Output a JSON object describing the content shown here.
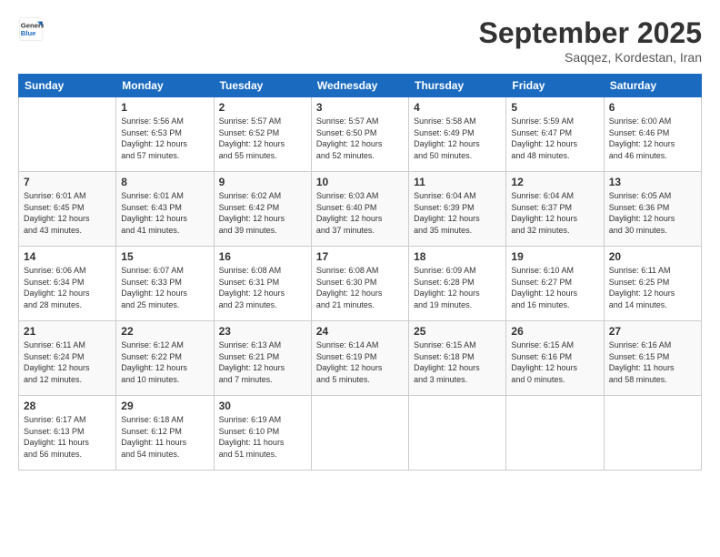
{
  "header": {
    "logo_line1": "General",
    "logo_line2": "Blue",
    "month_title": "September 2025",
    "location": "Saqqez, Kordestan, Iran"
  },
  "weekdays": [
    "Sunday",
    "Monday",
    "Tuesday",
    "Wednesday",
    "Thursday",
    "Friday",
    "Saturday"
  ],
  "weeks": [
    [
      {
        "day": "",
        "info": ""
      },
      {
        "day": "1",
        "info": "Sunrise: 5:56 AM\nSunset: 6:53 PM\nDaylight: 12 hours\nand 57 minutes."
      },
      {
        "day": "2",
        "info": "Sunrise: 5:57 AM\nSunset: 6:52 PM\nDaylight: 12 hours\nand 55 minutes."
      },
      {
        "day": "3",
        "info": "Sunrise: 5:57 AM\nSunset: 6:50 PM\nDaylight: 12 hours\nand 52 minutes."
      },
      {
        "day": "4",
        "info": "Sunrise: 5:58 AM\nSunset: 6:49 PM\nDaylight: 12 hours\nand 50 minutes."
      },
      {
        "day": "5",
        "info": "Sunrise: 5:59 AM\nSunset: 6:47 PM\nDaylight: 12 hours\nand 48 minutes."
      },
      {
        "day": "6",
        "info": "Sunrise: 6:00 AM\nSunset: 6:46 PM\nDaylight: 12 hours\nand 46 minutes."
      }
    ],
    [
      {
        "day": "7",
        "info": "Sunrise: 6:01 AM\nSunset: 6:45 PM\nDaylight: 12 hours\nand 43 minutes."
      },
      {
        "day": "8",
        "info": "Sunrise: 6:01 AM\nSunset: 6:43 PM\nDaylight: 12 hours\nand 41 minutes."
      },
      {
        "day": "9",
        "info": "Sunrise: 6:02 AM\nSunset: 6:42 PM\nDaylight: 12 hours\nand 39 minutes."
      },
      {
        "day": "10",
        "info": "Sunrise: 6:03 AM\nSunset: 6:40 PM\nDaylight: 12 hours\nand 37 minutes."
      },
      {
        "day": "11",
        "info": "Sunrise: 6:04 AM\nSunset: 6:39 PM\nDaylight: 12 hours\nand 35 minutes."
      },
      {
        "day": "12",
        "info": "Sunrise: 6:04 AM\nSunset: 6:37 PM\nDaylight: 12 hours\nand 32 minutes."
      },
      {
        "day": "13",
        "info": "Sunrise: 6:05 AM\nSunset: 6:36 PM\nDaylight: 12 hours\nand 30 minutes."
      }
    ],
    [
      {
        "day": "14",
        "info": "Sunrise: 6:06 AM\nSunset: 6:34 PM\nDaylight: 12 hours\nand 28 minutes."
      },
      {
        "day": "15",
        "info": "Sunrise: 6:07 AM\nSunset: 6:33 PM\nDaylight: 12 hours\nand 25 minutes."
      },
      {
        "day": "16",
        "info": "Sunrise: 6:08 AM\nSunset: 6:31 PM\nDaylight: 12 hours\nand 23 minutes."
      },
      {
        "day": "17",
        "info": "Sunrise: 6:08 AM\nSunset: 6:30 PM\nDaylight: 12 hours\nand 21 minutes."
      },
      {
        "day": "18",
        "info": "Sunrise: 6:09 AM\nSunset: 6:28 PM\nDaylight: 12 hours\nand 19 minutes."
      },
      {
        "day": "19",
        "info": "Sunrise: 6:10 AM\nSunset: 6:27 PM\nDaylight: 12 hours\nand 16 minutes."
      },
      {
        "day": "20",
        "info": "Sunrise: 6:11 AM\nSunset: 6:25 PM\nDaylight: 12 hours\nand 14 minutes."
      }
    ],
    [
      {
        "day": "21",
        "info": "Sunrise: 6:11 AM\nSunset: 6:24 PM\nDaylight: 12 hours\nand 12 minutes."
      },
      {
        "day": "22",
        "info": "Sunrise: 6:12 AM\nSunset: 6:22 PM\nDaylight: 12 hours\nand 10 minutes."
      },
      {
        "day": "23",
        "info": "Sunrise: 6:13 AM\nSunset: 6:21 PM\nDaylight: 12 hours\nand 7 minutes."
      },
      {
        "day": "24",
        "info": "Sunrise: 6:14 AM\nSunset: 6:19 PM\nDaylight: 12 hours\nand 5 minutes."
      },
      {
        "day": "25",
        "info": "Sunrise: 6:15 AM\nSunset: 6:18 PM\nDaylight: 12 hours\nand 3 minutes."
      },
      {
        "day": "26",
        "info": "Sunrise: 6:15 AM\nSunset: 6:16 PM\nDaylight: 12 hours\nand 0 minutes."
      },
      {
        "day": "27",
        "info": "Sunrise: 6:16 AM\nSunset: 6:15 PM\nDaylight: 11 hours\nand 58 minutes."
      }
    ],
    [
      {
        "day": "28",
        "info": "Sunrise: 6:17 AM\nSunset: 6:13 PM\nDaylight: 11 hours\nand 56 minutes."
      },
      {
        "day": "29",
        "info": "Sunrise: 6:18 AM\nSunset: 6:12 PM\nDaylight: 11 hours\nand 54 minutes."
      },
      {
        "day": "30",
        "info": "Sunrise: 6:19 AM\nSunset: 6:10 PM\nDaylight: 11 hours\nand 51 minutes."
      },
      {
        "day": "",
        "info": ""
      },
      {
        "day": "",
        "info": ""
      },
      {
        "day": "",
        "info": ""
      },
      {
        "day": "",
        "info": ""
      }
    ]
  ]
}
